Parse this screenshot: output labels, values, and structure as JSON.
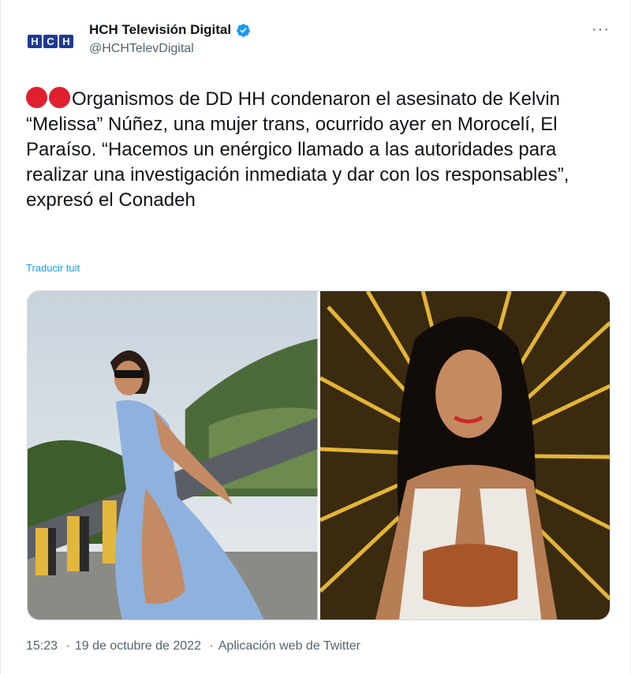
{
  "account": {
    "display_name": "HCH Televisión Digital",
    "handle": "@HCHTelevDigital",
    "avatar_letters": [
      "H",
      "C",
      "H"
    ]
  },
  "tweet": {
    "text": "Organismos de DD HH condenaron el asesinato de Kelvin “Melissa” Núñez, una mujer trans, ocurrido ayer en Morocelí, El Paraíso. “Hacemos un enérgico llamado a las autoridades para realizar una investigación inmediata y dar con los responsables”, expresó el Conadeh",
    "translate_label": "Traducir tuit",
    "more_label": "···"
  },
  "footer": {
    "time": "15:23",
    "date": "19 de octubre de 2022",
    "separator": "·",
    "source": "Aplicación web de Twitter"
  },
  "colors": {
    "accent": "#1d9bf0",
    "dot_red": "#e0202e",
    "muted": "#536471"
  },
  "icons": {
    "verified": "verified-badge-icon",
    "more": "more-options-icon"
  }
}
